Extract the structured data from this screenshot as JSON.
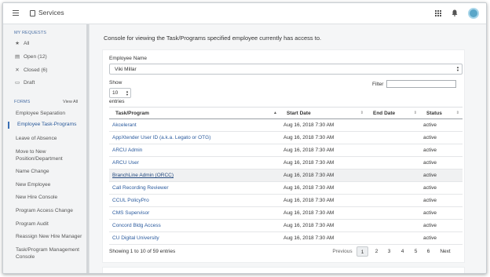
{
  "topbar": {
    "title": "Services",
    "icons": [
      "menu-icon",
      "document-icon",
      "apps-grid-icon",
      "bell-icon",
      "avatar"
    ]
  },
  "sidebar": {
    "requests_label": "MY REQUESTS",
    "requests": [
      {
        "icon": "star-icon",
        "glyph": "★",
        "label": "All"
      },
      {
        "icon": "folder-icon",
        "glyph": "▤",
        "label": "Open (12)"
      },
      {
        "icon": "close-icon",
        "glyph": "✕",
        "label": "Closed (6)"
      },
      {
        "icon": "draft-icon",
        "glyph": "▭",
        "label": "Draft"
      }
    ],
    "forms_label": "FORMS",
    "view_all": "View All",
    "forms": [
      "Employee Separation",
      "Employee Task-Programs",
      "Leave of Absence",
      "Move to New Position/Department",
      "Name Change",
      "New Employee",
      "New Hire Console",
      "Program Access Change",
      "Program Audit",
      "Reassign New Hire Manager",
      "Task/Program Management Console"
    ],
    "active_form": "Employee Task-Programs"
  },
  "main": {
    "intro": "Console for viewing the Task/Programs specified employee currently has access to.",
    "employee_label": "Employee Name",
    "employee_value": "Viki Millar",
    "show_label": "Show",
    "entries_value": "10",
    "entries_label": "entries",
    "filter_label": "Filter",
    "columns": [
      "Task/Program",
      "Start Date",
      "End Date",
      "Status"
    ],
    "rows": [
      {
        "program": "Akcelerant",
        "start": "Aug 16, 2018 7:30 AM",
        "end": "",
        "status": "active"
      },
      {
        "program": "AppXtender User ID (a.k.a. Legato or OTG)",
        "start": "Aug 16, 2018 7:30 AM",
        "end": "",
        "status": "active"
      },
      {
        "program": "ARCU Admin",
        "start": "Aug 16, 2018 7:30 AM",
        "end": "",
        "status": "active"
      },
      {
        "program": "ARCU User",
        "start": "Aug 16, 2018 7:30 AM",
        "end": "",
        "status": "active"
      },
      {
        "program": "BranchLine Admin (ORCC)",
        "start": "Aug 16, 2018 7:30 AM",
        "end": "",
        "status": "active"
      },
      {
        "program": "Call Recording Reviewer",
        "start": "Aug 16, 2018 7:30 AM",
        "end": "",
        "status": "active"
      },
      {
        "program": "CCUL PolicyPro",
        "start": "Aug 16, 2018 7:30 AM",
        "end": "",
        "status": "active"
      },
      {
        "program": "CMS Supervisor",
        "start": "Aug 16, 2018 7:30 AM",
        "end": "",
        "status": "active"
      },
      {
        "program": "Concord Bldg Access",
        "start": "Aug 16, 2018 7:30 AM",
        "end": "",
        "status": "active"
      },
      {
        "program": "CU Digital University",
        "start": "Aug 16, 2018 7:30 AM",
        "end": "",
        "status": "active"
      }
    ],
    "highlighted_row": 4,
    "info": "Showing 1 to 10 of 59 entries",
    "pager": {
      "previous": "Previous",
      "pages": [
        "1",
        "2",
        "3",
        "4",
        "5",
        "6"
      ],
      "current": "1",
      "next": "Next"
    }
  }
}
